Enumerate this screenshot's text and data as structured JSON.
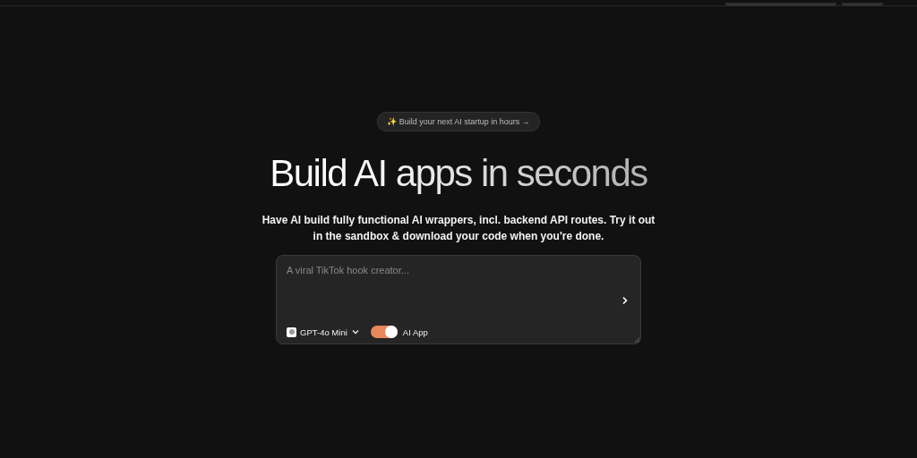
{
  "badge": {
    "label": "✨ Build your next AI startup in hours →"
  },
  "headline": "Build AI apps in seconds",
  "subtitle": "Have AI build fully functional AI wrappers, incl. backend API routes. Try it out in the sandbox & download your code when you're done.",
  "prompt": {
    "placeholder": "A viral TikTok hook creator...",
    "model": "GPT-4o Mini",
    "toggle": {
      "label": "AI App",
      "on": true
    }
  }
}
